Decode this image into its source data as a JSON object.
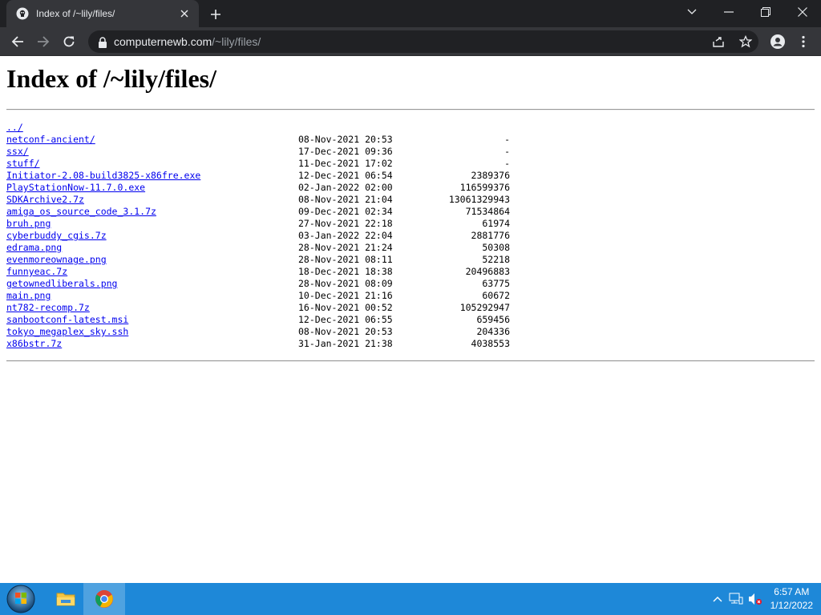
{
  "browser": {
    "tab_title": "Index of /~lily/files/",
    "url_host": "computernewb.com",
    "url_path": "/~lily/files/"
  },
  "page": {
    "heading": "Index of /~lily/files/",
    "parent_link": "../",
    "entries": [
      {
        "name": "netconf-ancient/",
        "date": "08-Nov-2021 20:53",
        "size": "-"
      },
      {
        "name": "ssx/",
        "date": "17-Dec-2021 09:36",
        "size": "-"
      },
      {
        "name": "stuff/",
        "date": "11-Dec-2021 17:02",
        "size": "-"
      },
      {
        "name": "Initiator-2.08-build3825-x86fre.exe",
        "date": "12-Dec-2021 06:54",
        "size": "2389376"
      },
      {
        "name": "PlayStationNow-11.7.0.exe",
        "date": "02-Jan-2022 02:00",
        "size": "116599376"
      },
      {
        "name": "SDKArchive2.7z",
        "date": "08-Nov-2021 21:04",
        "size": "13061329943"
      },
      {
        "name": "amiga_os_source_code_3.1.7z",
        "date": "09-Dec-2021 02:34",
        "size": "71534864"
      },
      {
        "name": "bruh.png",
        "date": "27-Nov-2021 22:18",
        "size": "61974"
      },
      {
        "name": "cyberbuddy_cgis.7z",
        "date": "03-Jan-2022 22:04",
        "size": "2881776"
      },
      {
        "name": "edrama.png",
        "date": "28-Nov-2021 21:24",
        "size": "50308"
      },
      {
        "name": "evenmoreownage.png",
        "date": "28-Nov-2021 08:11",
        "size": "52218"
      },
      {
        "name": "funnyeac.7z",
        "date": "18-Dec-2021 18:38",
        "size": "20496883"
      },
      {
        "name": "getownedliberals.png",
        "date": "28-Nov-2021 08:09",
        "size": "63775"
      },
      {
        "name": "main.png",
        "date": "10-Dec-2021 21:16",
        "size": "60672"
      },
      {
        "name": "nt782-recomp.7z",
        "date": "16-Nov-2021 00:52",
        "size": "105292947"
      },
      {
        "name": "sanbootconf-latest.msi",
        "date": "12-Dec-2021 06:55",
        "size": "659456"
      },
      {
        "name": "tokyo_megaplex_sky.ssh",
        "date": "08-Nov-2021 20:53",
        "size": "204336"
      },
      {
        "name": "x86bstr.7z",
        "date": "31-Jan-2021 21:38",
        "size": "4038553"
      }
    ]
  },
  "taskbar": {
    "time": "6:57 AM",
    "date": "1/12/2022"
  },
  "icons": {
    "favicon": "pirate-flag-icon",
    "tab_close": "close-icon",
    "new_tab": "plus-icon",
    "back": "back-arrow-icon",
    "forward": "forward-arrow-icon",
    "reload": "reload-icon",
    "lock": "lock-icon",
    "share": "share-icon",
    "bookmark": "star-icon",
    "profile": "profile-icon",
    "menu": "kebab-menu-icon"
  },
  "colors": {
    "link": "#0000ee",
    "chrome_dark": "#202124",
    "chrome_toolbar": "#35363a",
    "taskbar": "#1e88d8"
  }
}
